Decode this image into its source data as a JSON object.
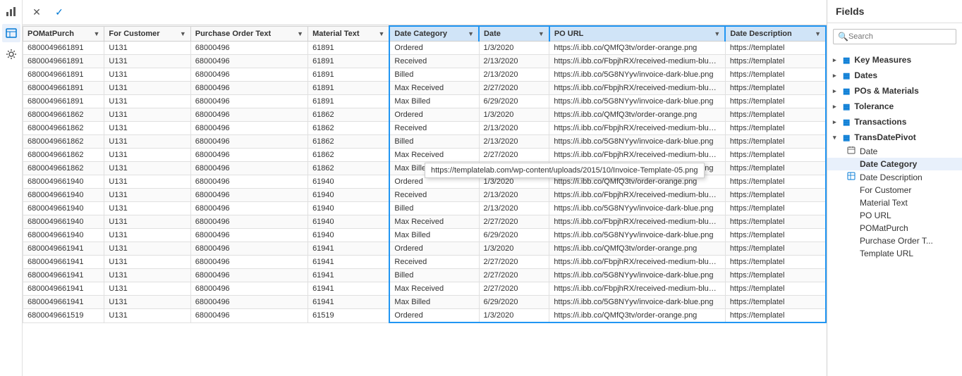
{
  "toolbar": {
    "close_label": "✕",
    "check_label": "✓"
  },
  "table": {
    "columns": [
      {
        "id": "POMatPurch",
        "label": "POMatPurch",
        "highlighted": false
      },
      {
        "id": "ForCustomer",
        "label": "For Customer",
        "highlighted": false
      },
      {
        "id": "PurchaseOrderText",
        "label": "Purchase Order Text",
        "highlighted": false
      },
      {
        "id": "MaterialText",
        "label": "Material Text",
        "highlighted": false
      },
      {
        "id": "DateCategory",
        "label": "Date Category",
        "highlighted": true
      },
      {
        "id": "Date",
        "label": "Date",
        "highlighted": true
      },
      {
        "id": "POURL",
        "label": "PO URL",
        "highlighted": true
      },
      {
        "id": "DateDescription",
        "label": "Date Description",
        "highlighted": true
      }
    ],
    "rows": [
      {
        "POMatPurch": "6800049661891",
        "ForCustomer": "U131",
        "PurchaseOrderText": "68000496",
        "MaterialText": "61891",
        "DateCategory": "Ordered",
        "Date": "1/3/2020",
        "POURL": "https://i.ibb.co/QMfQ3tv/order-orange.png",
        "DateDescription": "https://templatel"
      },
      {
        "POMatPurch": "6800049661891",
        "ForCustomer": "U131",
        "PurchaseOrderText": "68000496",
        "MaterialText": "61891",
        "DateCategory": "Received",
        "Date": "2/13/2020",
        "POURL": "https://i.ibb.co/FbpjhRX/received-medium-blue.png",
        "DateDescription": "https://templatel"
      },
      {
        "POMatPurch": "6800049661891",
        "ForCustomer": "U131",
        "PurchaseOrderText": "68000496",
        "MaterialText": "61891",
        "DateCategory": "Billed",
        "Date": "2/13/2020",
        "POURL": "https://i.ibb.co/5G8NYyv/invoice-dark-blue.png",
        "DateDescription": "https://templatel"
      },
      {
        "POMatPurch": "6800049661891",
        "ForCustomer": "U131",
        "PurchaseOrderText": "68000496",
        "MaterialText": "61891",
        "DateCategory": "Max Received",
        "Date": "2/27/2020",
        "POURL": "https://i.ibb.co/FbpjhRX/received-medium-blue.png",
        "DateDescription": "https://templatel"
      },
      {
        "POMatPurch": "6800049661891",
        "ForCustomer": "U131",
        "PurchaseOrderText": "68000496",
        "MaterialText": "61891",
        "DateCategory": "Max Billed",
        "Date": "6/29/2020",
        "POURL": "https://i.ibb.co/5G8NYyv/invoice-dark-blue.png",
        "DateDescription": "https://templatel"
      },
      {
        "POMatPurch": "6800049661862",
        "ForCustomer": "U131",
        "PurchaseOrderText": "68000496",
        "MaterialText": "61862",
        "DateCategory": "Ordered",
        "Date": "1/3/2020",
        "POURL": "https://i.ibb.co/QMfQ3tv/order-orange.png",
        "DateDescription": "https://templatel"
      },
      {
        "POMatPurch": "6800049661862",
        "ForCustomer": "U131",
        "PurchaseOrderText": "68000496",
        "MaterialText": "61862",
        "DateCategory": "Received",
        "Date": "2/13/2020",
        "POURL": "https://i.ibb.co/FbpjhRX/received-medium-blue.png",
        "DateDescription": "https://templatel"
      },
      {
        "POMatPurch": "6800049661862",
        "ForCustomer": "U131",
        "PurchaseOrderText": "68000496",
        "MaterialText": "61862",
        "DateCategory": "Billed",
        "Date": "2/13/2020",
        "POURL": "https://i.ibb.co/5G8NYyv/invoice-dark-blue.png",
        "DateDescription": "https://templatel"
      },
      {
        "POMatPurch": "6800049661862",
        "ForCustomer": "U131",
        "PurchaseOrderText": "68000496",
        "MaterialText": "61862",
        "DateCategory": "Max Received",
        "Date": "2/27/2020",
        "POURL": "https://i.ibb.co/FbpjhRX/received-medium-blue.png",
        "DateDescription": "https://templatel"
      },
      {
        "POMatPurch": "6800049661862",
        "ForCustomer": "U131",
        "PurchaseOrderText": "68000496",
        "MaterialText": "61862",
        "DateCategory": "Max Billed",
        "Date": "6/29/2020",
        "POURL": "https://i.ibb.co/5G8NYyv/invoice-dark-blue.png",
        "DateDescription": "https://templatel"
      },
      {
        "POMatPurch": "6800049661940",
        "ForCustomer": "U131",
        "PurchaseOrderText": "68000496",
        "MaterialText": "61940",
        "DateCategory": "Ordered",
        "Date": "1/3/2020",
        "POURL": "https://i.ibb.co/QMfQ3tv/order-orange.png",
        "DateDescription": "https://templatel"
      },
      {
        "POMatPurch": "6800049661940",
        "ForCustomer": "U131",
        "PurchaseOrderText": "68000496",
        "MaterialText": "61940",
        "DateCategory": "Received",
        "Date": "2/13/2020",
        "POURL": "https://i.ibb.co/FbpjhRX/received-medium-blue.png",
        "DateDescription": "https://templatel"
      },
      {
        "POMatPurch": "6800049661940",
        "ForCustomer": "U131",
        "PurchaseOrderText": "68000496",
        "MaterialText": "61940",
        "DateCategory": "Billed",
        "Date": "2/13/2020",
        "POURL": "https://i.ibb.co/5G8NYyv/invoice-dark-blue.png",
        "DateDescription": "https://templatel"
      },
      {
        "POMatPurch": "6800049661940",
        "ForCustomer": "U131",
        "PurchaseOrderText": "68000496",
        "MaterialText": "61940",
        "DateCategory": "Max Received",
        "Date": "2/27/2020",
        "POURL": "https://i.ibb.co/FbpjhRX/received-medium-blue.png",
        "DateDescription": "https://templatel"
      },
      {
        "POMatPurch": "6800049661940",
        "ForCustomer": "U131",
        "PurchaseOrderText": "68000496",
        "MaterialText": "61940",
        "DateCategory": "Max Billed",
        "Date": "6/29/2020",
        "POURL": "https://i.ibb.co/5G8NYyv/invoice-dark-blue.png",
        "DateDescription": "https://templatel"
      },
      {
        "POMatPurch": "6800049661941",
        "ForCustomer": "U131",
        "PurchaseOrderText": "68000496",
        "MaterialText": "61941",
        "DateCategory": "Ordered",
        "Date": "1/3/2020",
        "POURL": "https://i.ibb.co/QMfQ3tv/order-orange.png",
        "DateDescription": "https://templatel"
      },
      {
        "POMatPurch": "6800049661941",
        "ForCustomer": "U131",
        "PurchaseOrderText": "68000496",
        "MaterialText": "61941",
        "DateCategory": "Received",
        "Date": "2/27/2020",
        "POURL": "https://i.ibb.co/FbpjhRX/received-medium-blue.png",
        "DateDescription": "https://templatel"
      },
      {
        "POMatPurch": "6800049661941",
        "ForCustomer": "U131",
        "PurchaseOrderText": "68000496",
        "MaterialText": "61941",
        "DateCategory": "Billed",
        "Date": "2/27/2020",
        "POURL": "https://i.ibb.co/5G8NYyv/invoice-dark-blue.png",
        "DateDescription": "https://templatel"
      },
      {
        "POMatPurch": "6800049661941",
        "ForCustomer": "U131",
        "PurchaseOrderText": "68000496",
        "MaterialText": "61941",
        "DateCategory": "Max Received",
        "Date": "2/27/2020",
        "POURL": "https://i.ibb.co/FbpjhRX/received-medium-blue.png",
        "DateDescription": "https://templatel"
      },
      {
        "POMatPurch": "6800049661941",
        "ForCustomer": "U131",
        "PurchaseOrderText": "68000496",
        "MaterialText": "61941",
        "DateCategory": "Max Billed",
        "Date": "6/29/2020",
        "POURL": "https://i.ibb.co/5G8NYyv/invoice-dark-blue.png",
        "DateDescription": "https://templatel"
      },
      {
        "POMatPurch": "6800049661519",
        "ForCustomer": "U131",
        "PurchaseOrderText": "68000496",
        "MaterialText": "61519",
        "DateCategory": "Ordered",
        "Date": "1/3/2020",
        "POURL": "https://i.ibb.co/QMfQ3tv/order-orange.png",
        "DateDescription": "https://templatel"
      }
    ]
  },
  "tooltip": {
    "text": "https://templatelab.com/wp-content/uploads/2015/10/Invoice-Template-05.png"
  },
  "right_panel": {
    "title": "Fields",
    "search": {
      "placeholder": "Search",
      "value": ""
    },
    "groups": [
      {
        "label": "Key Measures",
        "icon": "table",
        "expanded": false,
        "chevron": "▼",
        "items": []
      },
      {
        "label": "Dates",
        "icon": "table",
        "expanded": false,
        "chevron": "▼",
        "items": []
      },
      {
        "label": "POs & Materials",
        "icon": "table",
        "expanded": false,
        "chevron": "▼",
        "items": []
      },
      {
        "label": "Tolerance",
        "icon": "table",
        "expanded": false,
        "chevron": "▼",
        "items": []
      },
      {
        "label": "Transactions",
        "icon": "table",
        "expanded": false,
        "chevron": "▼",
        "items": []
      },
      {
        "label": "TransDatePivot",
        "icon": "table",
        "expanded": true,
        "chevron": "▲",
        "items": [
          {
            "label": "Date",
            "icon": "calendar",
            "type": "field"
          },
          {
            "label": "Date Category",
            "icon": "text",
            "type": "field",
            "active": true
          },
          {
            "label": "Date Description",
            "icon": "table",
            "type": "measure"
          },
          {
            "label": "For Customer",
            "icon": "text",
            "type": "field"
          },
          {
            "label": "Material Text",
            "icon": "text",
            "type": "field"
          },
          {
            "label": "PO URL",
            "icon": "text",
            "type": "field"
          },
          {
            "label": "POMatPurch",
            "icon": "text",
            "type": "field"
          },
          {
            "label": "Purchase Order T...",
            "icon": "text",
            "type": "field"
          },
          {
            "label": "Template URL",
            "icon": "text",
            "type": "field"
          }
        ]
      }
    ]
  }
}
